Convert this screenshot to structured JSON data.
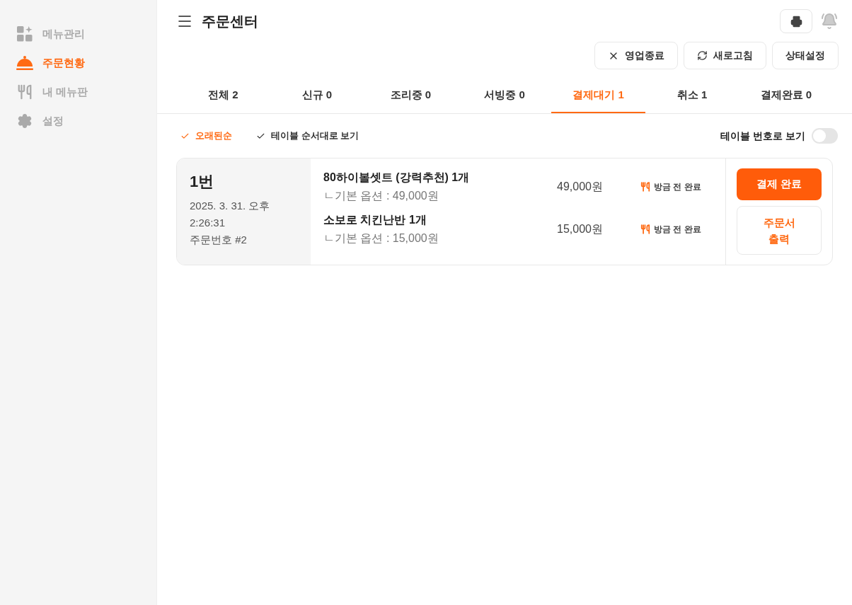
{
  "sidebar": {
    "items": [
      {
        "kind": "grid",
        "label": "메뉴관리",
        "selected": false
      },
      {
        "kind": "cloche",
        "label": "주문현황",
        "selected": true
      },
      {
        "kind": "utensils",
        "label": "내 메뉴판",
        "selected": false
      },
      {
        "kind": "gear",
        "label": "설정",
        "selected": false
      }
    ]
  },
  "header": {
    "title": "주문센터"
  },
  "actions": [
    {
      "kind": "close",
      "label": "영업종료"
    },
    {
      "kind": "refresh",
      "label": "새로고침"
    },
    {
      "kind": "plain",
      "label": "상태설정"
    }
  ],
  "tabs": [
    {
      "label": "전체 2",
      "selected": false
    },
    {
      "label": "신규 0",
      "selected": false
    },
    {
      "label": "조리중 0",
      "selected": false
    },
    {
      "label": "서빙중 0",
      "selected": false
    },
    {
      "label": "결제대기 1",
      "selected": true
    },
    {
      "label": "취소 1",
      "selected": false
    },
    {
      "label": "결제완료 0",
      "selected": false
    }
  ],
  "sort_options": [
    {
      "label": "오래된순",
      "selected": true
    },
    {
      "label": "테이블 순서대로 보기",
      "selected": false
    }
  ],
  "table_number_toggle": {
    "label": "테이블 번호로 보기",
    "on": false
  },
  "orders": [
    {
      "table": "1번",
      "time": "2025. 3. 31. 오후 2:26:31",
      "order_number": "주문번호 #2",
      "items": [
        {
          "name": "80하이볼셋트 (강력추천) 1개",
          "option": "ㄴ기본 옵션 : 49,000원",
          "price": "49,000원",
          "status": "방금 전 완료"
        },
        {
          "name": "소보로 치킨난반 1개",
          "option": "ㄴ기본 옵션 : 15,000원",
          "price": "15,000원",
          "status": "방금 전 완료"
        }
      ],
      "primary_button": "결제 완료",
      "secondary_button": "주문서 출력"
    }
  ]
}
